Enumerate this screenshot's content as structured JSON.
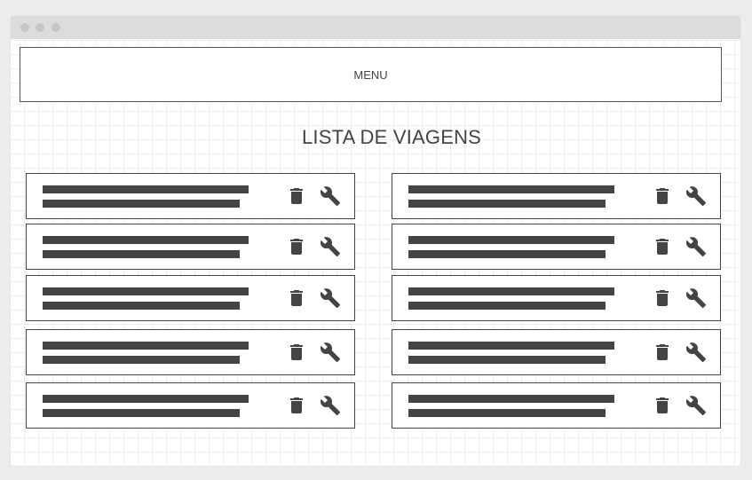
{
  "menu": {
    "label": "MENU"
  },
  "page": {
    "title": "LISTA DE VIAGENS"
  },
  "trips": {
    "count": 10,
    "item_actions": [
      "trash-icon",
      "wrench-icon"
    ]
  },
  "colors": {
    "background": "#ececec",
    "titlebar": "#dcdcdc",
    "ink": "#444444"
  }
}
